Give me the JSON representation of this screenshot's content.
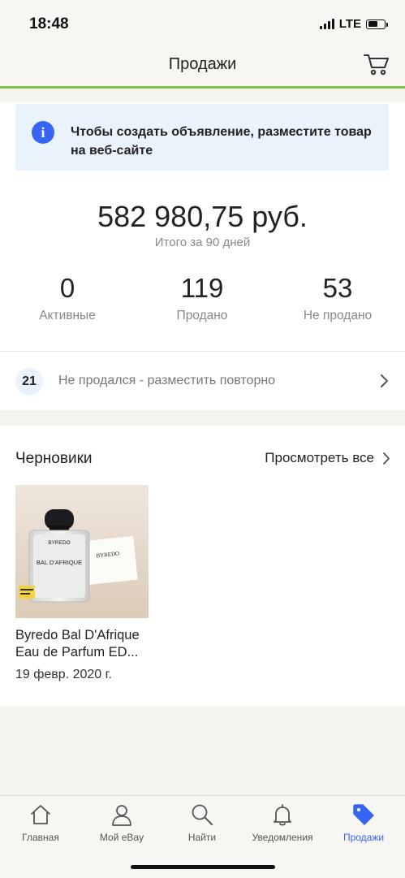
{
  "status_bar": {
    "time": "18:48",
    "network": "LTE"
  },
  "header": {
    "title": "Продажи"
  },
  "info_banner": {
    "text": "Чтобы создать объявление, разместите товар на веб-сайте"
  },
  "summary": {
    "total_amount": "582 980,75 руб.",
    "total_label": "Итого за 90 дней",
    "stats": [
      {
        "value": "0",
        "label": "Активные"
      },
      {
        "value": "119",
        "label": "Продано"
      },
      {
        "value": "53",
        "label": "Не продано"
      }
    ]
  },
  "relist": {
    "count": "21",
    "text": "Не продался - разместить повторно"
  },
  "drafts": {
    "title": "Черновики",
    "see_all": "Просмотреть все",
    "items": [
      {
        "name": "Byredo Bal D'Afrique Eau de Parfum ED...",
        "date": "19 февр. 2020 г.",
        "image_text": {
          "bottle_brand": "BYREDO",
          "bottle_name": "BAL D'AFRIQUE",
          "box_brand": "BYREDO"
        }
      }
    ]
  },
  "tab_bar": {
    "tabs": [
      {
        "label": "Главная",
        "icon": "home-icon",
        "active": false
      },
      {
        "label": "Мой eBay",
        "icon": "profile-icon",
        "active": false
      },
      {
        "label": "Найти",
        "icon": "search-icon",
        "active": false
      },
      {
        "label": "Уведомления",
        "icon": "bell-icon",
        "active": false
      },
      {
        "label": "Продажи",
        "icon": "tag-icon",
        "active": true
      }
    ]
  },
  "colors": {
    "accent": "#3665f3",
    "header_underline": "#7dc243",
    "info_bg": "#eaf3fc"
  }
}
